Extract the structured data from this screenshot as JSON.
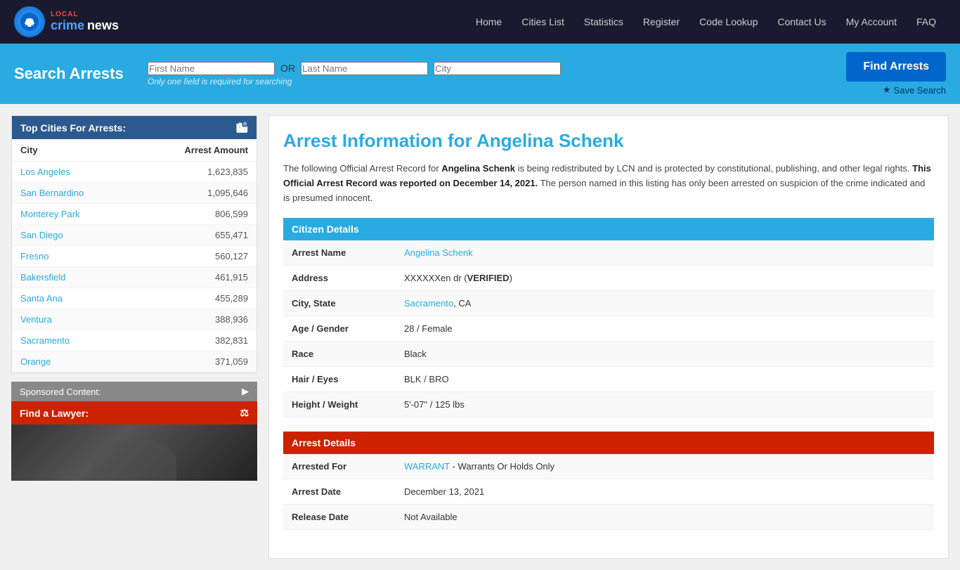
{
  "nav": {
    "logo_local": "LOCAL",
    "logo_crime": "crime",
    "logo_news": "news",
    "links": [
      {
        "label": "Home",
        "id": "nav-home"
      },
      {
        "label": "Cities List",
        "id": "nav-cities"
      },
      {
        "label": "Statistics",
        "id": "nav-statistics"
      },
      {
        "label": "Register",
        "id": "nav-register"
      },
      {
        "label": "Code Lookup",
        "id": "nav-code-lookup"
      },
      {
        "label": "Contact Us",
        "id": "nav-contact"
      },
      {
        "label": "My Account",
        "id": "nav-account"
      },
      {
        "label": "FAQ",
        "id": "nav-faq"
      }
    ]
  },
  "search": {
    "title": "Search Arrests",
    "first_name_placeholder": "First Name",
    "last_name_placeholder": "Last Name",
    "city_placeholder": "City",
    "or_label": "OR",
    "hint": "Only one field is required for searching",
    "find_btn": "Find Arrests",
    "save_btn": "Save Search"
  },
  "sidebar": {
    "top_cities_header": "Top Cities For Arrests:",
    "col_city": "City",
    "col_arrests": "Arrest Amount",
    "cities": [
      {
        "name": "Los Angeles",
        "count": "1,623,835"
      },
      {
        "name": "San Bernardino",
        "count": "1,095,646"
      },
      {
        "name": "Monterey Park",
        "count": "806,599"
      },
      {
        "name": "San Diego",
        "count": "655,471"
      },
      {
        "name": "Fresno",
        "count": "560,127"
      },
      {
        "name": "Bakersfield",
        "count": "461,915"
      },
      {
        "name": "Santa Ana",
        "count": "455,289"
      },
      {
        "name": "Ventura",
        "count": "388,936"
      },
      {
        "name": "Sacramento",
        "count": "382,831"
      },
      {
        "name": "Orange",
        "count": "371,059"
      }
    ],
    "sponsored_header": "Sponsored Content:",
    "find_lawyer_label": "Find a Lawyer:"
  },
  "arrest_info": {
    "title": "Arrest Information for Angelina Schenk",
    "description_intro": "The following Official Arrest Record for",
    "person_name_bold": "Angelina Schenk",
    "description_mid": "is being redistributed by LCN and is protected by constitutional, publishing, and other legal rights.",
    "date_bold": "This Official Arrest Record was reported on December 14, 2021.",
    "description_end": "The person named in this listing has only been arrested on suspicion of the crime indicated and is presumed innocent.",
    "citizen_header": "Citizen Details",
    "arrest_header": "Arrest Details",
    "fields": {
      "arrest_name_label": "Arrest Name",
      "arrest_name_value": "Angelina Schenk",
      "address_label": "Address",
      "address_value": "XXXXXXen dr",
      "address_verified": "VERIFIED",
      "city_state_label": "City, State",
      "city_value": "Sacramento",
      "state_value": ", CA",
      "age_gender_label": "Age / Gender",
      "age_gender_value": "28 / Female",
      "race_label": "Race",
      "race_value": "Black",
      "hair_eyes_label": "Hair / Eyes",
      "hair_eyes_value": "BLK / BRO",
      "height_weight_label": "Height / Weight",
      "height_weight_value": "5'-07\" / 125 lbs",
      "arrested_for_label": "Arrested For",
      "arrested_for_link": "WARRANT",
      "arrested_for_value": " - Warrants Or Holds Only",
      "arrest_date_label": "Arrest Date",
      "arrest_date_value": "December 13, 2021",
      "release_date_label": "Release Date",
      "release_date_value": "Not Available"
    }
  },
  "colors": {
    "primary_blue": "#29abe2",
    "dark_navy": "#1a1a2e",
    "sidebar_blue": "#2d5a8e",
    "red": "#cc2200"
  }
}
